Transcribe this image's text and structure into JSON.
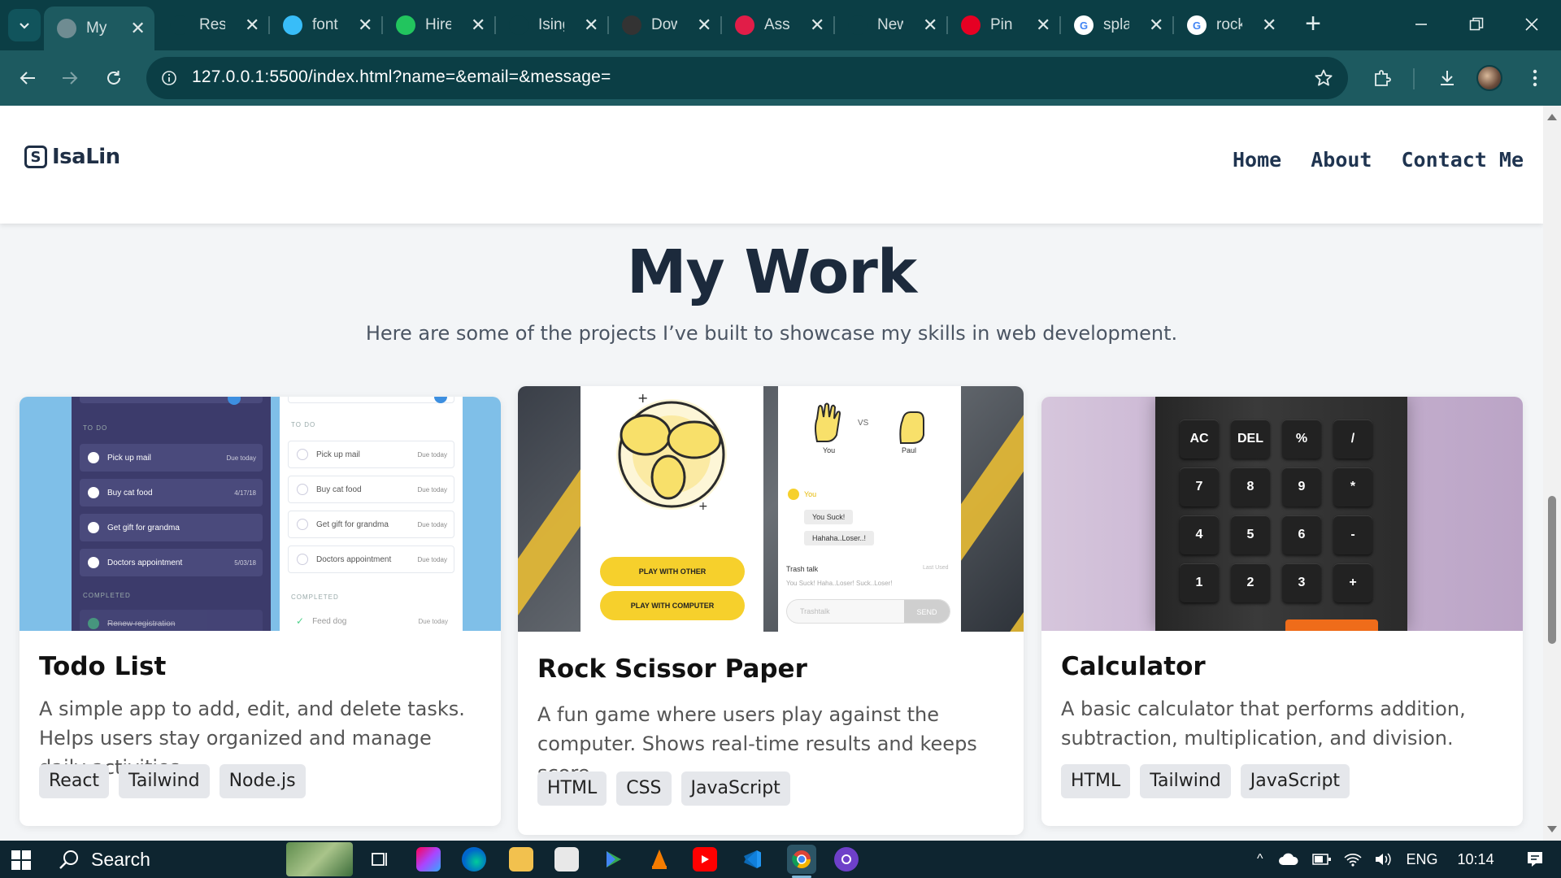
{
  "browser": {
    "tabs": [
      {
        "title": "My ",
        "icon": "globe-icon",
        "color": "#6f8c92"
      },
      {
        "title": "Resp",
        "icon": "openai-icon",
        "color": "#0b3e45"
      },
      {
        "title": "font",
        "icon": "tailwind-icon",
        "color": "#38bdf8"
      },
      {
        "title": "Hire",
        "icon": "green-diamond-icon",
        "color": "#22c55e"
      },
      {
        "title": "Ising",
        "icon": "github-icon",
        "color": "#0b3e45"
      },
      {
        "title": "Dow",
        "icon": "xfs-icon",
        "color": "#333333"
      },
      {
        "title": "Assi",
        "icon": "red-gear-icon",
        "color": "#e11d48"
      },
      {
        "title": "New",
        "icon": "chrome-icon",
        "color": "#0b3e45"
      },
      {
        "title": "Pin",
        "icon": "pinterest-icon",
        "color": "#e60023"
      },
      {
        "title": "spla",
        "icon": "google-icon",
        "color": "#ffffff"
      },
      {
        "title": "rock",
        "icon": "google-icon",
        "color": "#ffffff"
      }
    ],
    "url": "127.0.0.1:5500/index.html?name=&email=&message="
  },
  "site": {
    "logo": "IsaLin",
    "logo_mark": "S",
    "nav": [
      "Home",
      "About",
      "Contact Me"
    ]
  },
  "section": {
    "title": "My Work",
    "subtitle": "Here are some of the projects I’ve built to showcase my skills in web development."
  },
  "projects": [
    {
      "title": "Todo List",
      "description": "A simple app to add, edit, and delete tasks. Helps users stay organized and manage daily activities.",
      "tags": [
        "React",
        "Tailwind",
        "Node.js"
      ],
      "preview": {
        "section_todo": "TO DO",
        "section_completed": "COMPLETED",
        "dark_items": [
          {
            "label": "Pick up mail",
            "due": "Due today"
          },
          {
            "label": "Buy cat food",
            "due": "4/17/18"
          },
          {
            "label": "Get gift for grandma",
            "due": ""
          },
          {
            "label": "Doctors appointment",
            "due": "5/03/18"
          }
        ],
        "dark_completed": "Renew registration",
        "light_items": [
          {
            "label": "Pick up mail",
            "due": "Due today"
          },
          {
            "label": "Buy cat food",
            "due": "Due today"
          },
          {
            "label": "Get gift for grandma",
            "due": "Due today"
          },
          {
            "label": "Doctors appointment",
            "due": "Due today"
          }
        ],
        "light_completed": "Feed dog",
        "light_completed_due": "Due today"
      }
    },
    {
      "title": "Rock Scissor Paper",
      "description": "A fun game where users play against the computer. Shows real-time results and keeps score.",
      "tags": [
        "HTML",
        "CSS",
        "JavaScript"
      ],
      "preview": {
        "btn_other": "PLAY WITH OTHER",
        "btn_computer": "PLAY WITH COMPUTER",
        "vs": "VS",
        "player_you": "You",
        "player_other": "Paul",
        "chat_you": "You",
        "msg1": "You Suck!",
        "msg2": "Hahaha..Loser..!",
        "trash_talk": "Trash talk",
        "last_used": "Last Used",
        "quick_replies": "You Suck!  Haha..Loser!  Suck..Loser!",
        "input_placeholder": "Trashtalk",
        "send": "SEND"
      }
    },
    {
      "title": "Calculator",
      "description": "A basic calculator that performs addition, subtraction, multiplication, and division.",
      "tags": [
        "HTML",
        "Tailwind",
        "JavaScript"
      ],
      "preview": {
        "keys": [
          "AC",
          "DEL",
          "%",
          "/",
          "7",
          "8",
          "9",
          "*",
          "4",
          "5",
          "6",
          "-",
          "1",
          "2",
          "3",
          "+"
        ]
      }
    }
  ],
  "taskbar": {
    "search_label": "Search",
    "language": "ENG",
    "time": "10:14"
  }
}
